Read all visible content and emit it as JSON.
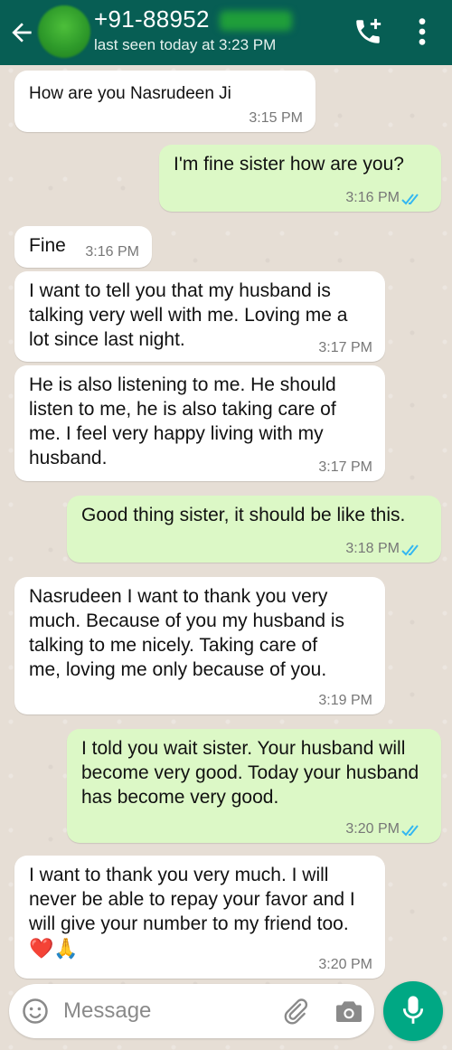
{
  "header": {
    "contact": "+91-88952",
    "status": "last seen today at 3:23 PM"
  },
  "messages": [
    {
      "dir": "in",
      "text": "How are you Nasrudeen Ji",
      "time": "3:15 PM"
    },
    {
      "dir": "out",
      "text": "I'm fine sister how are you?",
      "time": "3:16 PM",
      "read": true
    },
    {
      "dir": "in",
      "text": "Fine",
      "time": "3:16 PM"
    },
    {
      "dir": "in",
      "text": "I want to tell you that my husband is talking very well with me. Loving me a lot since last night.",
      "time": "3:17 PM"
    },
    {
      "dir": "in",
      "text": "He is also listening to me. He should listen to me, he is also taking care of me. I feel very happy living with my husband.",
      "time": "3:17 PM"
    },
    {
      "dir": "out",
      "text": "Good thing sister, it should be like this.",
      "time": "3:18 PM",
      "read": true
    },
    {
      "dir": "in",
      "text": "Nasrudeen I want to thank you very much. Because of you my husband is talking to me nicely. Taking care of me, loving me only because of you.",
      "time": "3:19 PM"
    },
    {
      "dir": "out",
      "text": "I told you wait sister.  Your husband will become very good.  Today your husband has become very good.",
      "time": "3:20 PM",
      "read": true
    },
    {
      "dir": "in",
      "text": "I want to thank you very much. I will never be able to repay your favor and I will give your number to my friend too.",
      "emoji": "❤️🙏",
      "time": "3:20 PM"
    }
  ],
  "composer": {
    "placeholder": "Message"
  },
  "colors": {
    "header": "#075e54",
    "incoming": "#ffffff",
    "outgoing": "#dcf8c6",
    "read_ticks": "#34b7f1",
    "mic_button": "#00a884"
  },
  "icons": [
    "back-arrow-icon",
    "add-call-icon",
    "more-options-icon",
    "emoji-icon",
    "attach-icon",
    "camera-icon",
    "mic-icon",
    "double-check-icon"
  ]
}
